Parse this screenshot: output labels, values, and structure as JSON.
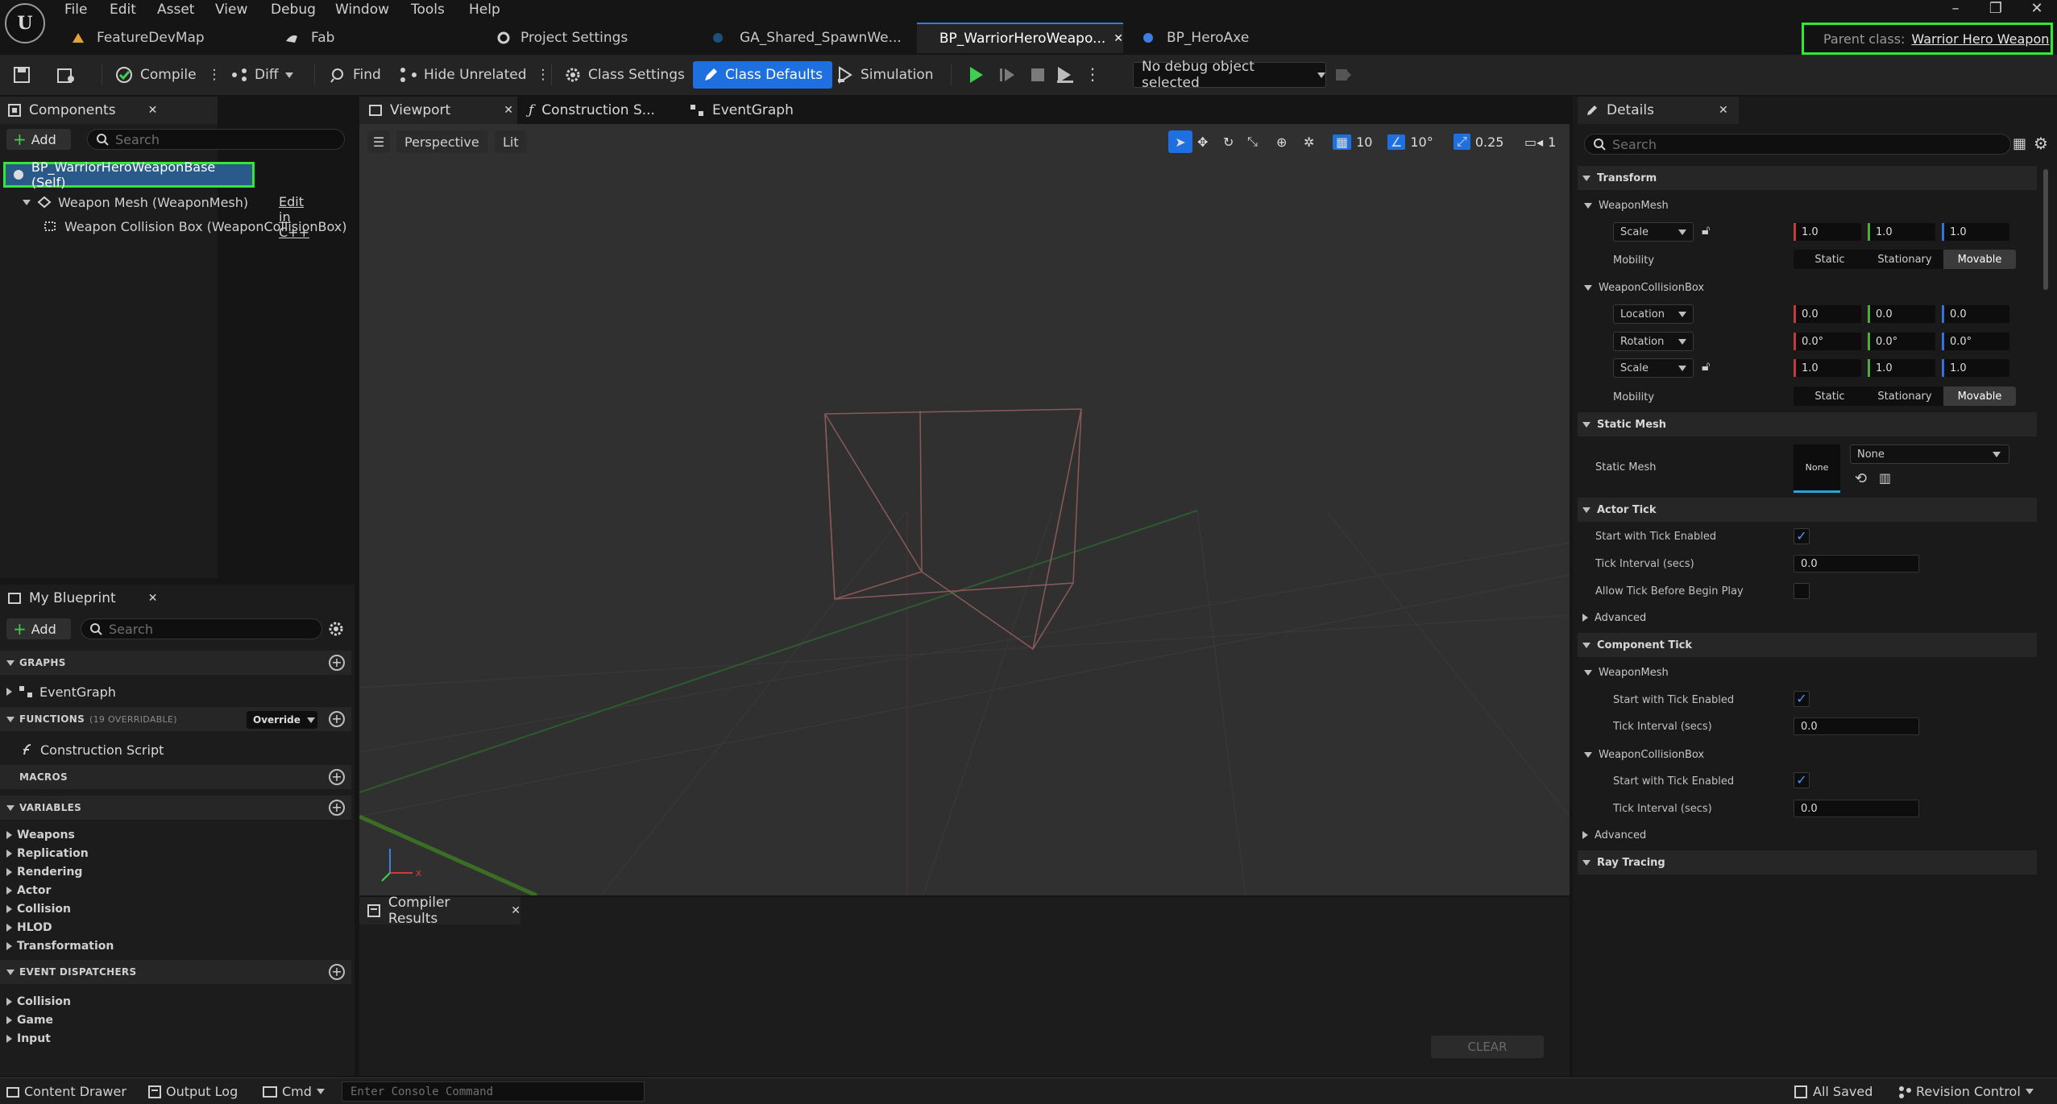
{
  "menu": [
    "File",
    "Edit",
    "Asset",
    "View",
    "Debug",
    "Window",
    "Tools",
    "Help"
  ],
  "window_controls": [
    "–",
    "❐",
    "✕"
  ],
  "doc_tabs": [
    {
      "label": "FeatureDevMap",
      "active": false
    },
    {
      "label": "Fab",
      "active": false
    },
    {
      "label": "Project Settings",
      "active": false
    },
    {
      "label": "GA_Shared_SpawnWe...",
      "active": false
    },
    {
      "label": "BP_WarriorHeroWeapo...",
      "active": true
    },
    {
      "label": "BP_HeroAxe",
      "active": false
    }
  ],
  "parent_class": {
    "label": "Parent class:",
    "value": "Warrior Hero Weapon"
  },
  "toolbar": {
    "compile": "Compile",
    "diff": "Diff",
    "find": "Find",
    "hide_unrelated": "Hide Unrelated",
    "class_settings": "Class Settings",
    "class_defaults": "Class Defaults",
    "simulation": "Simulation",
    "debug_object": "No debug object selected"
  },
  "components": {
    "title": "Components",
    "add": "Add",
    "search_placeholder": "Search",
    "items": [
      {
        "label": "BP_WarriorHeroWeaponBase (Self)"
      },
      {
        "label": "Weapon Mesh (WeaponMesh)",
        "link": "Edit in C++"
      },
      {
        "label": "Weapon Collision Box (WeaponCollisionBox)"
      }
    ]
  },
  "my_blueprint": {
    "title": "My Blueprint",
    "add": "Add",
    "search_placeholder": "Search",
    "graphs_header": "GRAPHS",
    "event_graph": "EventGraph",
    "functions_header": "FUNCTIONS",
    "functions_count": "(19 OVERRIDABLE)",
    "override": "Override",
    "construction_script": "Construction Script",
    "macros_header": "MACROS",
    "variables_header": "VARIABLES",
    "variables": [
      "Weapons",
      "Replication",
      "Rendering",
      "Actor",
      "Collision",
      "HLOD",
      "Transformation"
    ],
    "dispatchers_header": "EVENT DISPATCHERS",
    "dispatchers": [
      "Collision",
      "Game",
      "Input"
    ]
  },
  "editor_tabs": [
    "Viewport",
    "Construction S...",
    "EventGraph"
  ],
  "viewport": {
    "perspective": "Perspective",
    "lit": "Lit",
    "grid_snap": "10",
    "rot_snap": "10°",
    "scale_snap": "0.25",
    "cam_speed": "1"
  },
  "compiler": {
    "title": "Compiler Results",
    "clear": "CLEAR"
  },
  "details": {
    "title": "Details",
    "search_placeholder": "Search",
    "transform": "Transform",
    "weapon_mesh": "WeaponMesh",
    "scale": "Scale",
    "mobility": "Mobility",
    "mobility_opts": [
      "Static",
      "Stationary",
      "Movable"
    ],
    "weapon_collision_box": "WeaponCollisionBox",
    "location": "Location",
    "rotation": "Rotation",
    "mesh_scale": [
      "1.0",
      "1.0",
      "1.0"
    ],
    "loc": [
      "0.0",
      "0.0",
      "0.0"
    ],
    "rot": [
      "0.0°",
      "0.0°",
      "0.0°"
    ],
    "box_scale": [
      "1.0",
      "1.0",
      "1.0"
    ],
    "static_mesh_section": "Static Mesh",
    "static_mesh_label": "Static Mesh",
    "static_mesh_thumb": "None",
    "static_mesh_value": "None",
    "actor_tick": "Actor Tick",
    "start_tick": "Start with Tick Enabled",
    "tick_interval": "Tick Interval (secs)",
    "tick_value": "0.0",
    "allow_tick": "Allow Tick Before Begin Play",
    "advanced": "Advanced",
    "component_tick": "Component Tick",
    "ray_tracing": "Ray Tracing"
  },
  "status": {
    "content_drawer": "Content Drawer",
    "output_log": "Output Log",
    "cmd": "Cmd",
    "console_placeholder": "Enter Console Command",
    "all_saved": "All Saved",
    "revision_control": "Revision Control"
  }
}
